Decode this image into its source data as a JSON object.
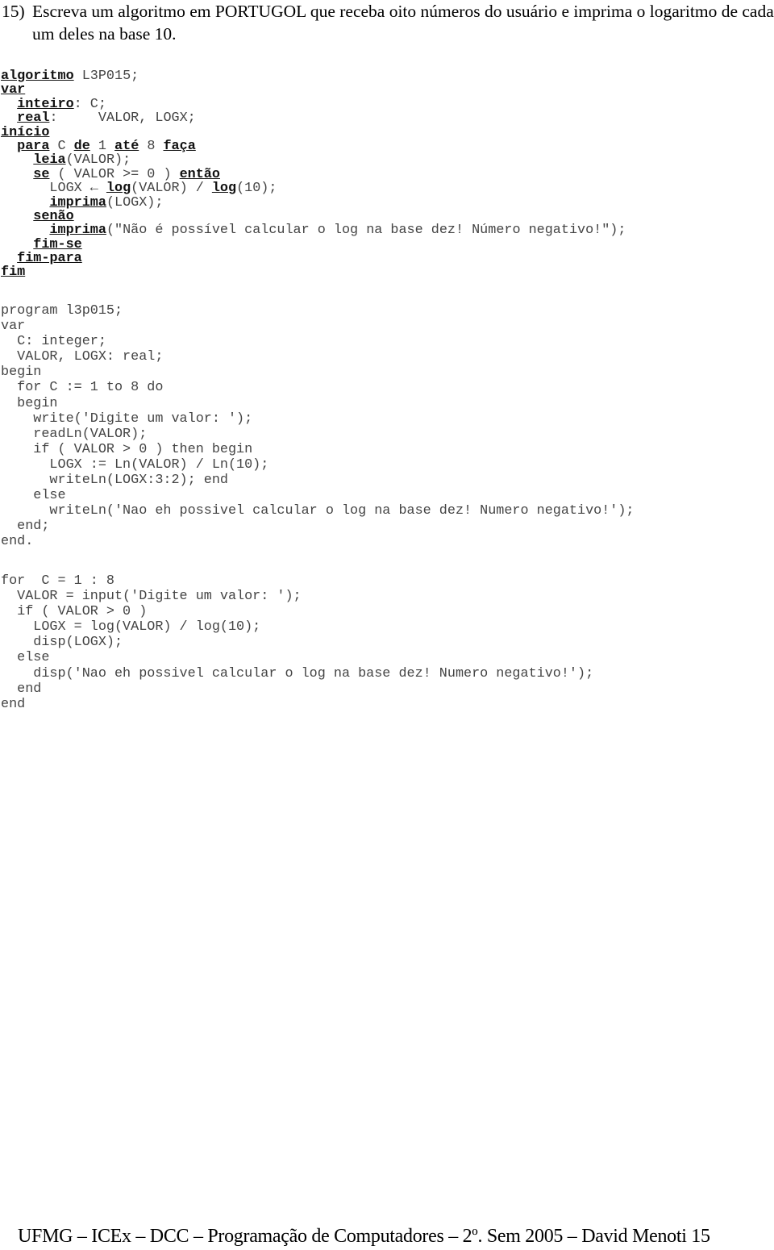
{
  "exercise": {
    "number": "15)",
    "text": "Escreva um algoritmo em PORTUGOL que receba oito números do usuário e imprima o logaritmo de cada um deles na base 10."
  },
  "portugol_code": [
    [
      [
        "algoritmo",
        1
      ],
      [
        " L3P015;",
        0
      ]
    ],
    [
      [
        "var",
        1
      ]
    ],
    [
      [
        "  ",
        0
      ],
      [
        "inteiro",
        1
      ],
      [
        ": C;",
        0
      ]
    ],
    [
      [
        "  ",
        0
      ],
      [
        "real",
        1
      ],
      [
        ":     VALOR, LOGX;",
        0
      ]
    ],
    [
      [
        "início",
        1
      ]
    ],
    [
      [
        "  ",
        0
      ],
      [
        "para",
        1
      ],
      [
        " C ",
        0
      ],
      [
        "de",
        1
      ],
      [
        " 1 ",
        0
      ],
      [
        "até",
        1
      ],
      [
        " 8 ",
        0
      ],
      [
        "faça",
        1
      ]
    ],
    [
      [
        "    ",
        0
      ],
      [
        "leia",
        1
      ],
      [
        "(VALOR);",
        0
      ]
    ],
    [
      [
        "    ",
        0
      ],
      [
        "se",
        1
      ],
      [
        " ( VALOR >= 0 ) ",
        0
      ],
      [
        "então",
        1
      ]
    ],
    [
      [
        "      LOGX ← ",
        0
      ],
      [
        "log",
        1
      ],
      [
        "(VALOR) / ",
        0
      ],
      [
        "log",
        1
      ],
      [
        "(10);",
        0
      ]
    ],
    [
      [
        "      ",
        0
      ],
      [
        "imprima",
        1
      ],
      [
        "(LOGX);",
        0
      ]
    ],
    [
      [
        "    ",
        0
      ],
      [
        "senão",
        1
      ]
    ],
    [
      [
        "      ",
        0
      ],
      [
        "imprima",
        1
      ],
      [
        "(\"Não é possível calcular o log na base dez! Número negativo!\");",
        0
      ]
    ],
    [
      [
        "    ",
        0
      ],
      [
        "fim-se",
        1
      ]
    ],
    [
      [
        "  ",
        0
      ],
      [
        "fim-para",
        1
      ]
    ],
    [
      [
        "fim",
        1
      ]
    ]
  ],
  "pascal_code": [
    "program l3p015;",
    "var",
    "  C: integer;",
    "  VALOR, LOGX: real;",
    "begin",
    "  for C := 1 to 8 do",
    "  begin",
    "    write('Digite um valor: ');",
    "    readLn(VALOR);",
    "    if ( VALOR > 0 ) then begin",
    "      LOGX := Ln(VALOR) / Ln(10);",
    "      writeLn(LOGX:3:2); end",
    "    else",
    "      writeLn('Nao eh possivel calcular o log na base dez! Numero negativo!');",
    "  end;",
    "end."
  ],
  "matlab_code": [
    "for  C = 1 : 8",
    "  VALOR = input('Digite um valor: ');",
    "  if ( VALOR > 0 )",
    "    LOGX = log(VALOR) / log(10);",
    "    disp(LOGX);",
    "  else",
    "    disp('Nao eh possivel calcular o log na base dez! Numero negativo!');",
    "  end",
    "end"
  ],
  "footer": "UFMG – ICEx – DCC – Programação de Computadores – 2º. Sem 2005 – David Menoti  15"
}
